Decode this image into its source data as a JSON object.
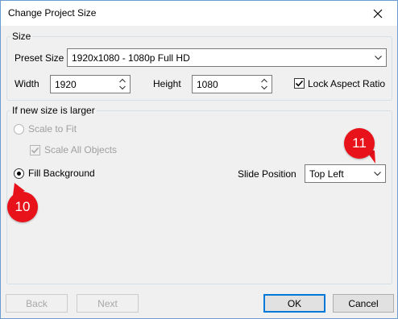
{
  "window": {
    "title": "Change Project Size"
  },
  "size_group": {
    "label": "Size",
    "preset_label": "Preset Size",
    "preset_value": "1920x1080 - 1080p Full HD",
    "width_label": "Width",
    "width_value": "1920",
    "height_label": "Height",
    "height_value": "1080",
    "lock_label": "Lock Aspect Ratio",
    "lock_checked": true
  },
  "larger_group": {
    "label": "If new size is larger",
    "scale_to_fit_label": "Scale to Fit",
    "scale_all_label": "Scale All Objects",
    "fill_background_label": "Fill Background",
    "slide_position_label": "Slide Position",
    "slide_position_value": "Top Left"
  },
  "callouts": {
    "fill_marker": "10",
    "slide_position_marker": "11"
  },
  "buttons": {
    "back": "Back",
    "next": "Next",
    "ok": "OK",
    "cancel": "Cancel"
  },
  "colors": {
    "callout": "#e8121b",
    "accent_border": "#0078d7"
  }
}
